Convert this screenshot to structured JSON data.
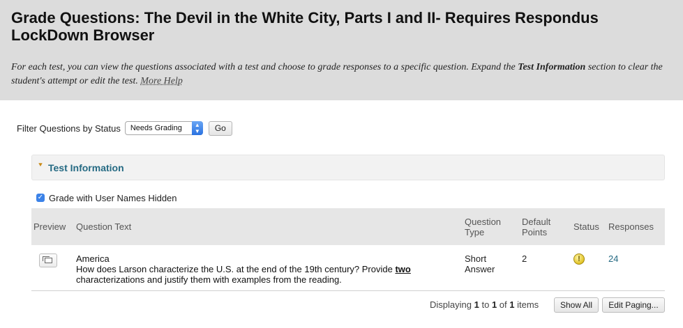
{
  "header": {
    "title": "Grade Questions: The Devil in the White City, Parts I and II- Requires Respondus LockDown Browser",
    "instructions_part1": "For each test, you can view the questions associated with a test and choose to grade responses to a specific question. Expand the ",
    "instructions_bold": "Test Information",
    "instructions_part2": " section to clear the student's attempt or edit the test. ",
    "more_help": "More Help"
  },
  "filter": {
    "label": "Filter Questions by Status",
    "selected": "Needs Grading",
    "go_label": "Go"
  },
  "test_information": {
    "title": "Test Information",
    "expanded": false
  },
  "grade_hidden": {
    "label": "Grade with User Names Hidden",
    "checked": true
  },
  "grid": {
    "headers": {
      "preview": "Preview",
      "question_text": "Question Text",
      "question_type": "Question Type",
      "default_points": "Default Points",
      "status": "Status",
      "responses": "Responses"
    },
    "rows": [
      {
        "title": "America",
        "text_before": "How does Larson characterize the U.S. at the end of the 19th century? Provide ",
        "text_emphasis": "two",
        "text_after": " characterizations and justify them with examples from the reading.",
        "type_line1": "Short",
        "type_line2": "Answer",
        "points": "2",
        "status_icon": "needs-grading-icon",
        "responses": "24"
      }
    ]
  },
  "footer": {
    "displaying_prefix": "Displaying",
    "from": "1",
    "to_word": "to",
    "to": "1",
    "of_word": "of",
    "total": "1",
    "items_word": "items",
    "show_all": "Show All",
    "edit_paging": "Edit Paging..."
  },
  "colors": {
    "header_bg": "#dcdcdc",
    "link_teal": "#256a83",
    "chevron_gold": "#c98a17",
    "checkbox_blue": "#3b82e8"
  }
}
